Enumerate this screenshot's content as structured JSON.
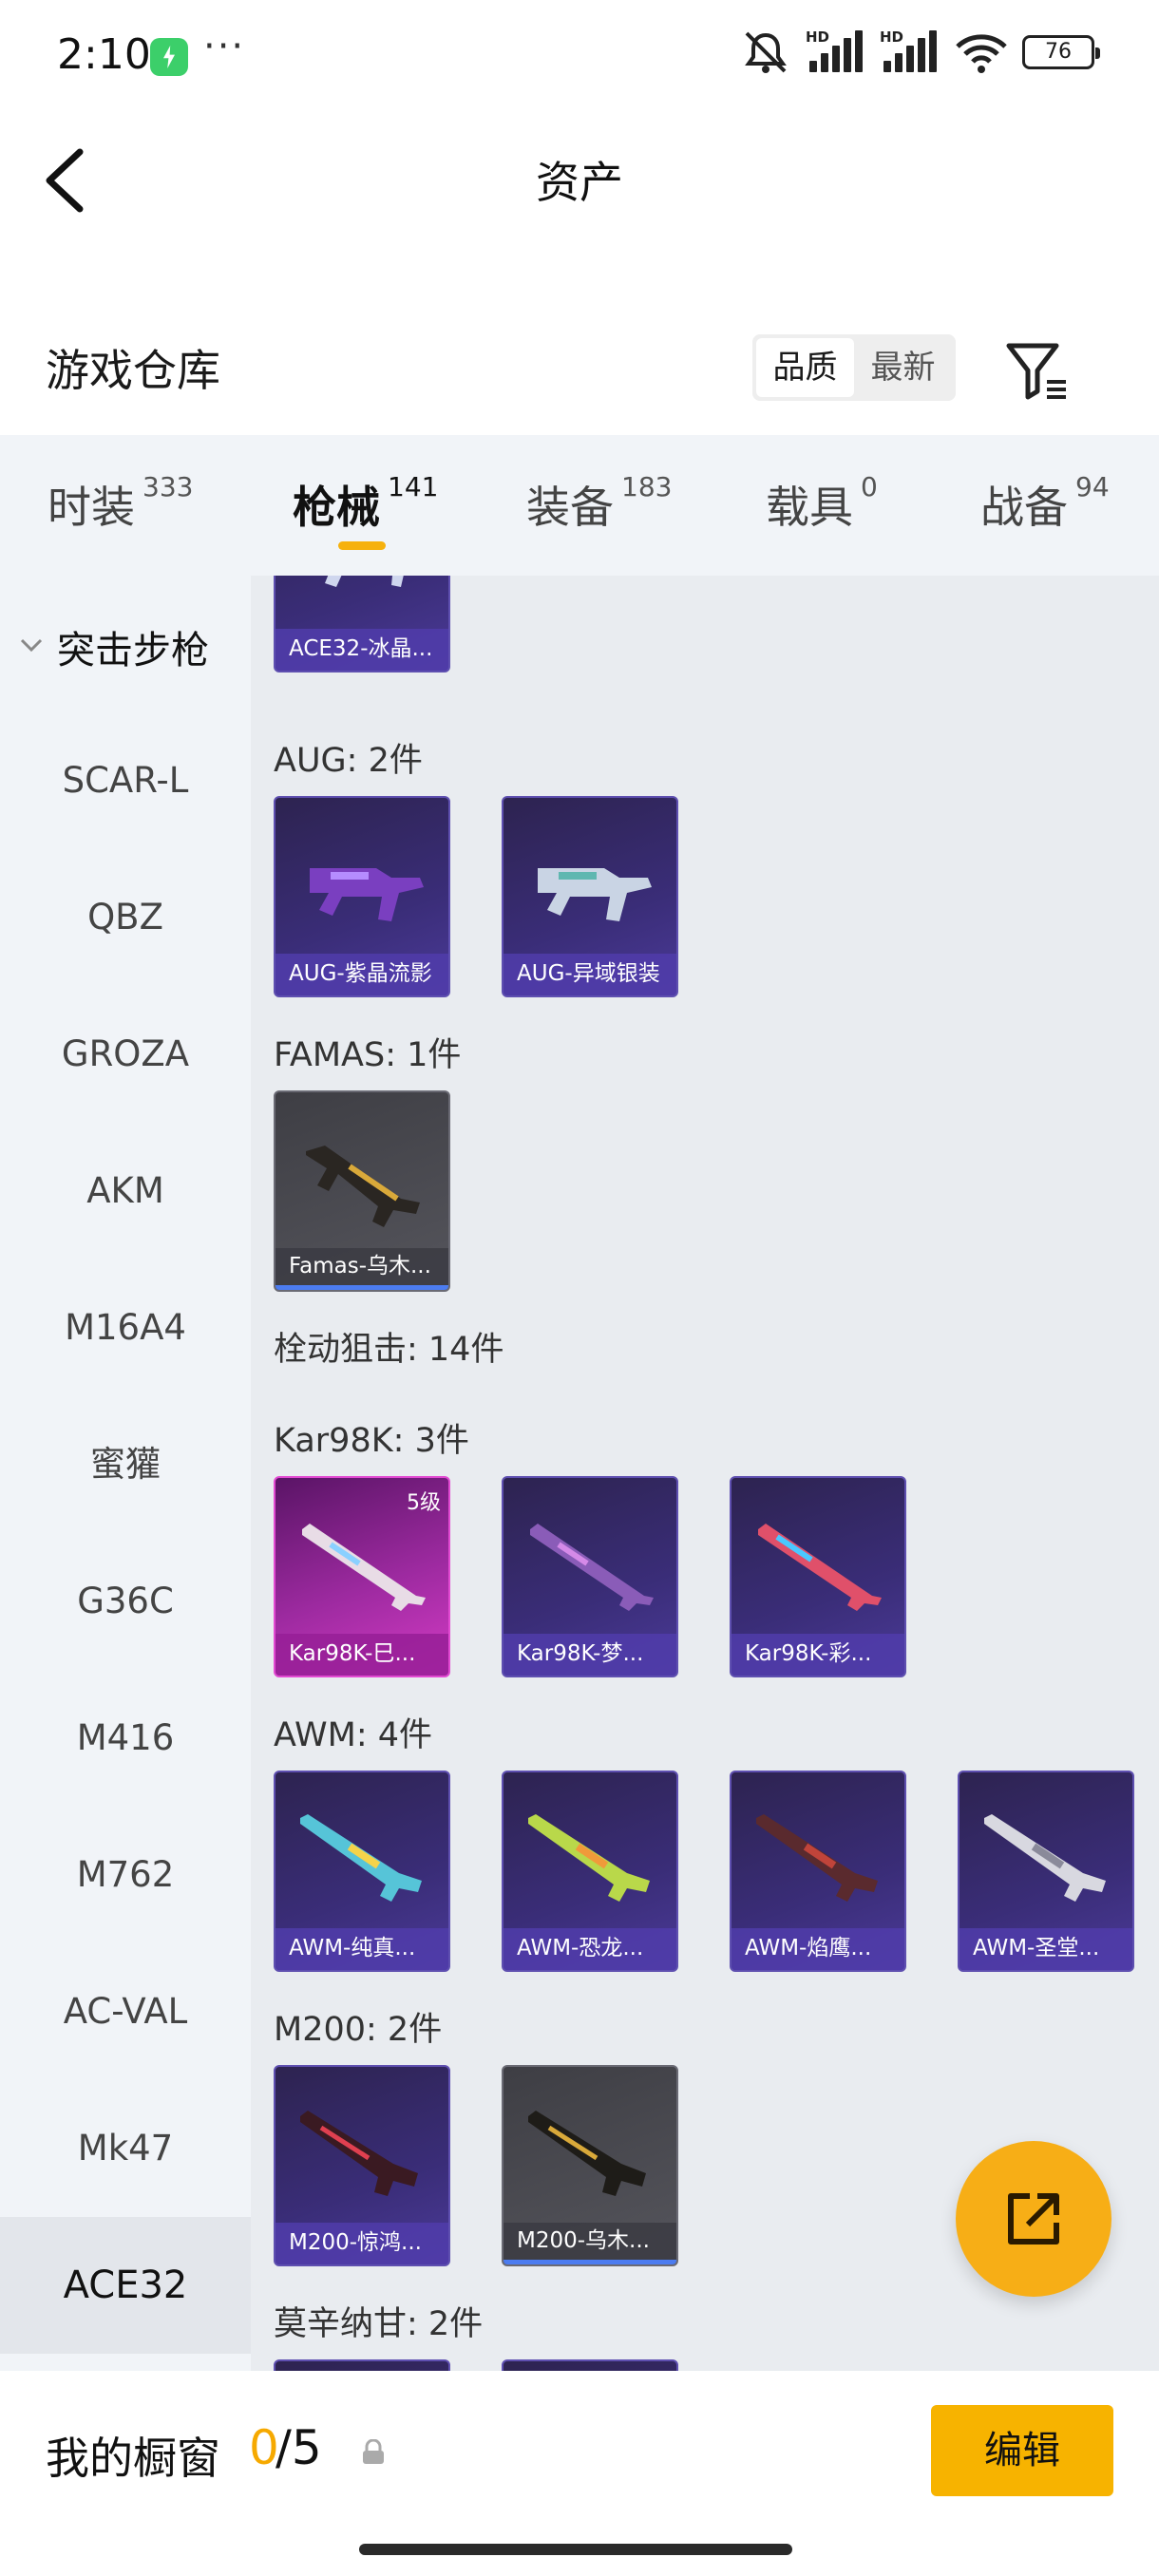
{
  "status_bar": {
    "time": "2:10",
    "more": "···",
    "battery": "76",
    "net_a": "HD",
    "net_b": "HD"
  },
  "header": {
    "title": "资产"
  },
  "warehouse": {
    "title": "游戏仓库",
    "sort_options": [
      "品质",
      "最新"
    ],
    "active_sort": "品质"
  },
  "tabs": [
    {
      "label": "时装",
      "count": "333"
    },
    {
      "label": "枪械",
      "count": "141"
    },
    {
      "label": "装备",
      "count": "183"
    },
    {
      "label": "载具",
      "count": "0"
    },
    {
      "label": "战备",
      "count": "94"
    }
  ],
  "sidebar": {
    "section": "突击步枪",
    "items": [
      "SCAR-L",
      "QBZ",
      "GROZA",
      "AKM",
      "M16A4",
      "蜜獾",
      "G36C",
      "M416",
      "M762",
      "AC-VAL",
      "Mk47",
      "ACE32"
    ],
    "active": "ACE32"
  },
  "content": {
    "groups": {
      "aug": "AUG: 2件",
      "famas": "FAMAS: 1件",
      "bolt": "栓动狙击: 14件",
      "kar": "Kar98K: 3件",
      "awm": "AWM: 4件",
      "m200": "M200: 2件",
      "mosin": "莫辛纳甘: 2件"
    },
    "cards": {
      "ace32": "ACE32-冰晶...",
      "aug1": "AUG-紫晶流影",
      "aug2": "AUG-异域银装",
      "famas1": "Famas-乌木...",
      "kar1": "Kar98K-巳...",
      "kar1_level": "5级",
      "kar2": "Kar98K-梦...",
      "kar3": "Kar98K-彩...",
      "awm1": "AWM-纯真...",
      "awm2": "AWM-恐龙...",
      "awm3": "AWM-焰鹰...",
      "awm4": "AWM-圣堂...",
      "m2001": "M200-惊鸿...",
      "m2002": "M200-乌木..."
    }
  },
  "showcase": {
    "title": "我的橱窗",
    "current": "0",
    "total": "/5",
    "edit_label": "编辑"
  },
  "colors": {
    "accent": "#f7b300",
    "tab_bg": "#f1f4f8",
    "content_bg": "#e9ecf0",
    "card_purple": "#3a2d78"
  }
}
